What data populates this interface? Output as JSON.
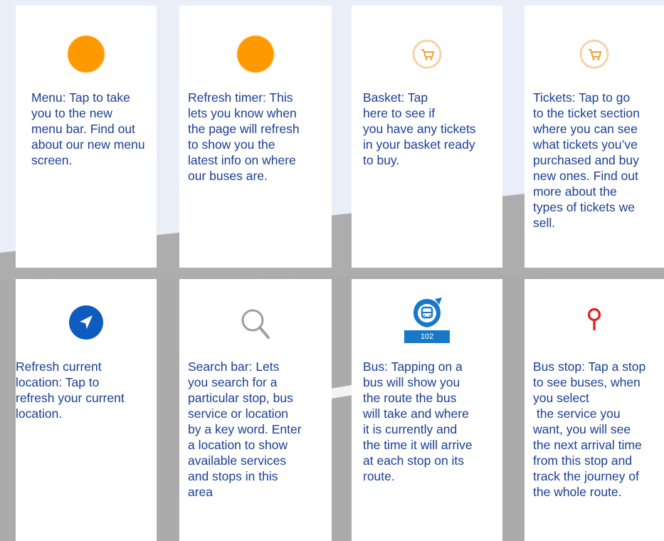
{
  "colors": {
    "background": "#ababab",
    "map_light": "#e9eef8",
    "card": "#ffffff",
    "text": "#1b3f94",
    "orange": "#ff9900",
    "basket_ring": "#f6d3a8",
    "location_blue": "#0e5cbf",
    "bus_blue": "#1878c8",
    "stop_red": "#e0201e"
  },
  "cards": [
    {
      "icon": "orange-dot-icon",
      "text": "Menu: Tap to take\nyou to the new\nmenu bar. Find out\nabout our new menu\nscreen."
    },
    {
      "icon": "orange-dot-icon",
      "text": "Refresh timer: This\nlets you know when\nthe page will refresh\nto show you the\nlatest info on where\nour buses are."
    },
    {
      "icon": "basket-icon",
      "text": "Basket: Tap\nhere to see if\nyou have any tickets\nin your basket ready\nto buy."
    },
    {
      "icon": "basket-icon",
      "text": "Tickets: Tap to go\nto the ticket section\nwhere you can see\nwhat tickets you’ve\npurchased and buy\nnew ones. Find out\nmore about the\ntypes of tickets we\nsell."
    },
    {
      "icon": "location-arrow-icon",
      "text": "Refresh current\nlocation: Tap to\nrefresh your current\nlocation."
    },
    {
      "icon": "search-icon",
      "text": "Search bar: Lets\nyou search for a\nparticular stop, bus\nservice or location\nby a key word. Enter\na location to show\navailable services\nand stops in this\narea"
    },
    {
      "icon": "bus-marker-icon",
      "bus_number": "102",
      "text": "Bus: Tapping on a\nbus will show you\nthe route the bus\nwill take and where\nit is currently and\nthe time it will arrive\nat each stop on its\nroute."
    },
    {
      "icon": "bus-stop-pin-icon",
      "text": "Bus stop: Tap a stop\nto see buses, when\nyou select\n the service you\nwant, you will see\nthe next arrival time\nfrom this stop and\ntrack the journey of\nthe whole route."
    }
  ]
}
